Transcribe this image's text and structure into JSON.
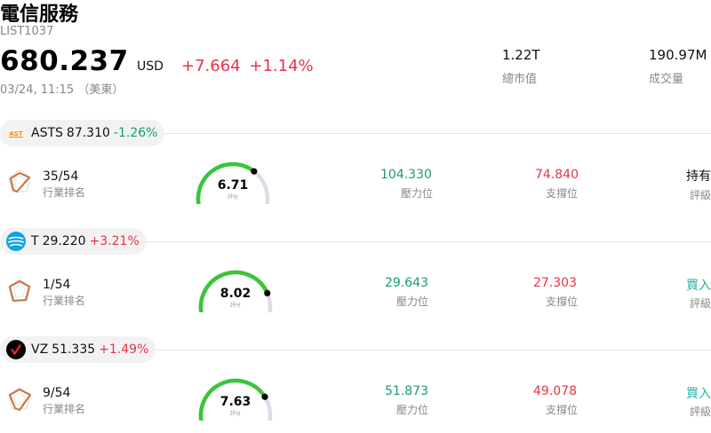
{
  "header": {
    "title": "電信服務",
    "code": "LIST1037",
    "price": "680.237",
    "currency": "USD",
    "change": "+7.664",
    "change_pct": "+1.14%",
    "time": "03/24, 11:15 （美東）",
    "market_cap_value": "1.22T",
    "market_cap_label": "總市值",
    "volume_value": "190.97M",
    "volume_label": "成交量"
  },
  "stocks": [
    {
      "symbol": "ASTS",
      "price": "87.310",
      "pct": "-1.26%",
      "direction": "down",
      "rank": "35/54",
      "rank_label": "行業排名",
      "score": "6.71",
      "score_value": 6.71,
      "score_label": "評分",
      "resistance": "104.330",
      "resistance_label": "壓力位",
      "support": "74.840",
      "support_label": "支撐位",
      "rating": "持有",
      "rating_label": "評級"
    },
    {
      "symbol": "T",
      "price": "29.220",
      "pct": "+3.21%",
      "direction": "up",
      "rank": "1/54",
      "rank_label": "行業排名",
      "score": "8.02",
      "score_value": 8.02,
      "score_label": "評分",
      "resistance": "29.643",
      "resistance_label": "壓力位",
      "support": "27.303",
      "support_label": "支撐位",
      "rating": "買入",
      "rating_label": "評級"
    },
    {
      "symbol": "VZ",
      "price": "51.335",
      "pct": "+1.49%",
      "direction": "up",
      "rank": "9/54",
      "rank_label": "行業排名",
      "score": "7.63",
      "score_value": 7.63,
      "score_label": "評分",
      "resistance": "51.873",
      "resistance_label": "壓力位",
      "support": "49.078",
      "support_label": "支撐位",
      "rating": "買入",
      "rating_label": "評級"
    }
  ],
  "colors": {
    "up": "#e8334a",
    "down": "#1a9b72",
    "buy": "#22b3a2",
    "gauge_fill": "#3cc43c",
    "gauge_track": "#dcdce6",
    "radar_stroke": "#c8703a"
  },
  "icons": [
    "asts-logo-icon",
    "att-logo-icon",
    "verizon-logo-icon",
    "radar-chart-icon",
    "score-gauge-icon"
  ]
}
